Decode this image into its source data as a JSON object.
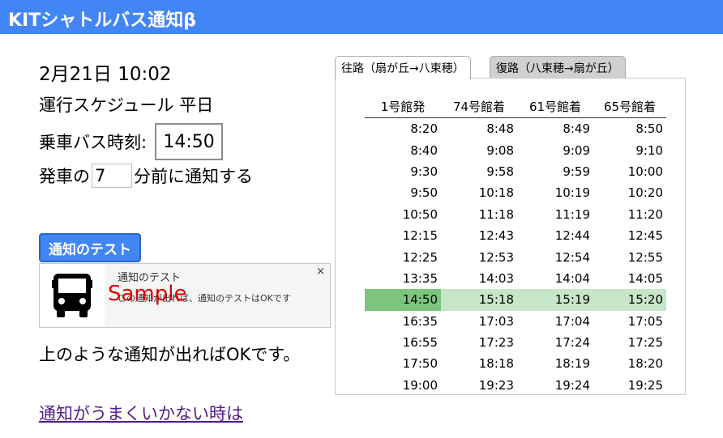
{
  "app": {
    "title": "KITシャトルバス通知β",
    "header_color": "#4285f4"
  },
  "info": {
    "datetime": "2月21日 10:02",
    "schedule": "運行スケジュール 平日",
    "ride_label": "乗車バス時刻:",
    "ride_time": "14:50",
    "notify_prefix": "発車の",
    "notify_minutes": "7",
    "notify_suffix": "分前に通知する"
  },
  "test": {
    "button_label": "通知のテスト",
    "notification_title": "通知のテスト",
    "notification_body": "この通知が出れば、通知のテストはOKです",
    "close": "×",
    "icon": "bus-icon",
    "sample": "Sample"
  },
  "ok_text": "上のような通知が出ればOKです。",
  "help_link": "通知がうまくいかない時は",
  "tabs": [
    {
      "label": "往路（扇が丘→八束穂）",
      "active": true
    },
    {
      "label": "復路（八束穂→扇が丘）",
      "active": false
    }
  ],
  "timetable": {
    "headers": [
      "1号館発",
      "74号館着",
      "61号館着",
      "65号館着"
    ],
    "rows": [
      [
        "8:20",
        "8:48",
        "8:49",
        "8:50"
      ],
      [
        "8:40",
        "9:08",
        "9:09",
        "9:10"
      ],
      [
        "9:30",
        "9:58",
        "9:59",
        "10:00"
      ],
      [
        "9:50",
        "10:18",
        "10:19",
        "10:20"
      ],
      [
        "10:50",
        "11:18",
        "11:19",
        "11:20"
      ],
      [
        "12:15",
        "12:43",
        "12:44",
        "12:45"
      ],
      [
        "12:25",
        "12:53",
        "12:54",
        "12:55"
      ],
      [
        "13:35",
        "14:03",
        "14:04",
        "14:05"
      ],
      [
        "14:50",
        "15:18",
        "15:19",
        "15:20"
      ],
      [
        "16:35",
        "17:03",
        "17:04",
        "17:05"
      ],
      [
        "16:55",
        "17:23",
        "17:24",
        "17:25"
      ],
      [
        "17:50",
        "18:18",
        "18:19",
        "18:20"
      ],
      [
        "19:00",
        "19:23",
        "19:24",
        "19:25"
      ]
    ],
    "selected_row": 8,
    "selected_color": "#7dc47d",
    "selected_row_color": "#c7e6c7"
  }
}
